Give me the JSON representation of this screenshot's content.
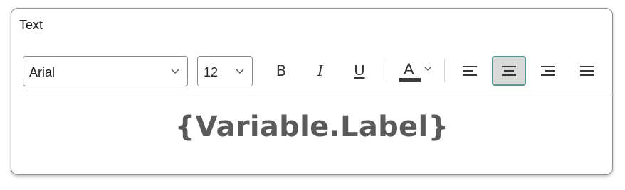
{
  "panel": {
    "title": "Text"
  },
  "toolbar": {
    "font_family": "Arial",
    "font_size": "12",
    "bold_glyph": "B",
    "italic_glyph": "I",
    "underline_glyph": "U",
    "font_color_glyph": "A",
    "font_color": "#3a3a3a",
    "alignment_selected": "center",
    "accent_color": "#4f9a8c"
  },
  "content": {
    "text": "{Variable.Label}"
  }
}
